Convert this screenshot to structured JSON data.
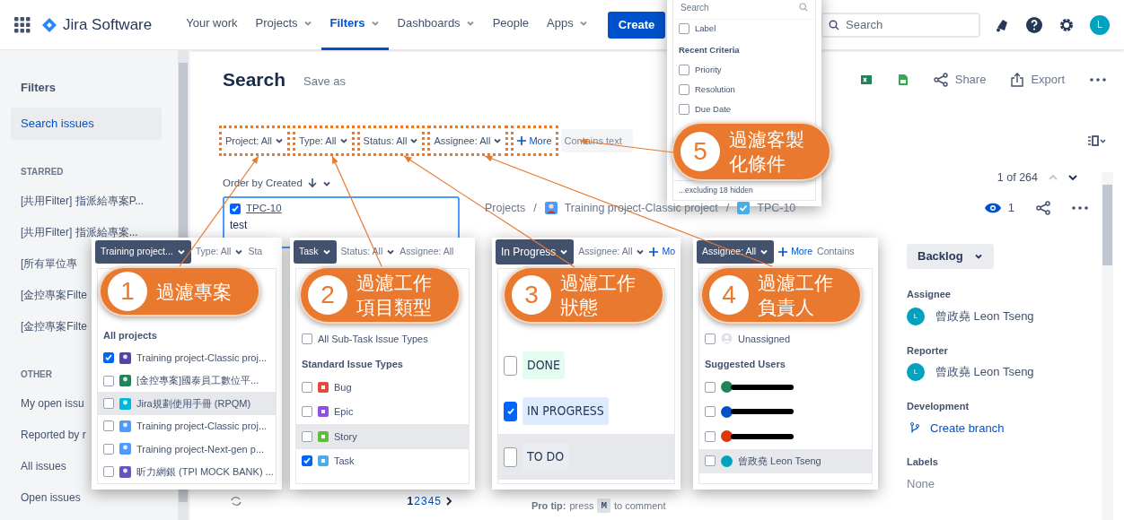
{
  "nav": {
    "product": "Jira Software",
    "items": [
      {
        "label": "Your work",
        "dropdown": false,
        "selected": false
      },
      {
        "label": "Projects",
        "dropdown": true,
        "selected": false
      },
      {
        "label": "Filters",
        "dropdown": true,
        "selected": true
      },
      {
        "label": "Dashboards",
        "dropdown": true,
        "selected": false
      },
      {
        "label": "People",
        "dropdown": false,
        "selected": false
      },
      {
        "label": "Apps",
        "dropdown": true,
        "selected": false
      }
    ],
    "create": "Create",
    "search_placeholder": "Search",
    "avatar": "L"
  },
  "sidebar": {
    "title": "Filters",
    "items": [
      {
        "label": "Search issues",
        "selected": true
      }
    ],
    "sections": [
      {
        "heading": "STARRED",
        "items": [
          "[共用Filter] 指派給專案P...",
          "[共用Filter] 指派給專案...",
          "[所有單位專",
          "[金控專案Filte",
          "[金控專案Filte"
        ]
      },
      {
        "heading": "OTHER",
        "items": [
          "My open issu",
          "Reported by r",
          "All issues",
          "Open issues"
        ]
      }
    ]
  },
  "header": {
    "title": "Search",
    "save_as": "Save as",
    "share": "Share",
    "export": "Export"
  },
  "filters": [
    {
      "kind": "filter",
      "label": "Project: All",
      "highlighted": true
    },
    {
      "kind": "filter",
      "label": "Type: All",
      "highlighted": true
    },
    {
      "kind": "filter",
      "label": "Status: All",
      "highlighted": true
    },
    {
      "kind": "filter",
      "label": "Assignee: All",
      "highlighted": true
    },
    {
      "kind": "more",
      "label": "More",
      "highlighted": true
    },
    {
      "kind": "search",
      "placeholder": "Contains text",
      "highlighted": false
    }
  ],
  "list": {
    "order": "Order by Created",
    "card": {
      "key": "TPC-10",
      "summary": "test",
      "checked": true
    },
    "pages": [
      {
        "label": "1",
        "selected": true
      },
      {
        "label": "2",
        "selected": false
      },
      {
        "label": "3",
        "selected": false
      },
      {
        "label": "4",
        "selected": false
      },
      {
        "label": "5",
        "selected": false
      }
    ]
  },
  "issue": {
    "separator": "/",
    "breadcrumbs": [
      "Projects",
      "Training project-Classic project",
      "TPC-10"
    ],
    "position": "1 of 264",
    "watchers": "1",
    "status": "Backlog",
    "fields": [
      {
        "label": "Assignee",
        "value": "曾政堯 Leon Tseng",
        "kind": "user",
        "avatar": "L"
      },
      {
        "label": "Reporter",
        "value": "曾政堯 Leon Tseng",
        "kind": "user",
        "avatar": "L"
      },
      {
        "label": "Development",
        "value": "Create branch",
        "kind": "link"
      },
      {
        "label": "Labels",
        "value": "None",
        "kind": "empty"
      }
    ],
    "tip": {
      "lead": "Pro tip:",
      "text": "press",
      "key": "M",
      "tail": "to comment"
    }
  },
  "popups": [
    {
      "kind": "criteria",
      "placeholder": "Search",
      "sections": [
        {
          "options": [
            {
              "kind": "plain",
              "label": "Label",
              "checked": false,
              "hovered": false
            }
          ]
        },
        {
          "heading": "Recent Criteria",
          "options": [
            {
              "kind": "plain",
              "label": "Priority",
              "checked": false,
              "hovered": false
            },
            {
              "kind": "plain",
              "label": "Resolution",
              "checked": false,
              "hovered": false
            },
            {
              "kind": "plain",
              "label": "Due Date",
              "checked": false,
              "hovered": false
            }
          ]
        }
      ],
      "footer": "...excluding 18 hidden"
    },
    {
      "kind": "project",
      "toolbar": [
        {
          "label": "Training project...",
          "active": true,
          "dropdown": true
        },
        {
          "label": "Type: All",
          "active": false,
          "dropdown": true
        },
        {
          "label": "Sta",
          "active": false,
          "dropdown": false
        }
      ],
      "sections": [
        {
          "heading": "All projects",
          "options": [
            {
              "kind": "project",
              "label": "Training project-Classic proj...",
              "checked": true,
              "hovered": false,
              "color": "#5243aa"
            },
            {
              "kind": "project",
              "label": "[金控專案]國泰員工數位平...",
              "checked": false,
              "hovered": false,
              "color": "#1f845a"
            },
            {
              "kind": "project",
              "label": "Jira規劃使用手冊 (RPQM)",
              "checked": false,
              "hovered": true,
              "color": "#00b8d9"
            },
            {
              "kind": "project",
              "label": "Training project-Classic proj...",
              "checked": false,
              "hovered": false,
              "color": "#4c9aff"
            },
            {
              "kind": "project",
              "label": "Training project-Next-gen p...",
              "checked": false,
              "hovered": false,
              "color": "#4c9aff"
            },
            {
              "kind": "project",
              "label": "昕力網銀 (TPI MOCK BANK) ...",
              "checked": false,
              "hovered": false,
              "color": "#6554c0"
            }
          ]
        }
      ]
    },
    {
      "kind": "type",
      "toolbar": [
        {
          "label": "Task",
          "active": true,
          "dropdown": true
        },
        {
          "label": "Status: All",
          "active": false,
          "dropdown": true
        },
        {
          "label": "Assignee: All",
          "active": false,
          "dropdown": false
        }
      ],
      "sections": [
        {
          "options": [
            {
              "kind": "plain",
              "label": "All Sub-Task Issue Types",
              "checked": false,
              "hovered": false
            }
          ]
        },
        {
          "heading": "Standard Issue Types",
          "options": [
            {
              "kind": "issue_type",
              "label": "Bug",
              "checked": false,
              "hovered": false,
              "color": "#e5493a"
            },
            {
              "kind": "issue_type",
              "label": "Epic",
              "checked": false,
              "hovered": false,
              "color": "#904ee2"
            },
            {
              "kind": "issue_type",
              "label": "Story",
              "checked": false,
              "hovered": true,
              "color": "#63ba3c"
            },
            {
              "kind": "issue_type",
              "label": "Task",
              "checked": true,
              "hovered": false,
              "color": "#4bade8"
            }
          ]
        }
      ]
    },
    {
      "kind": "status",
      "toolbar": [
        {
          "label": "In Progress",
          "active": true,
          "dropdown": true
        },
        {
          "label": "Assignee: All",
          "active": false,
          "dropdown": true
        },
        {
          "label": "Mo",
          "active": false,
          "dropdown": false,
          "plus": true
        }
      ],
      "sections": [
        {
          "options": [
            {
              "kind": "status",
              "label": "DONE",
              "checked": false,
              "hovered": false,
              "color": "#e3fcef"
            },
            {
              "kind": "status",
              "label": "IN PROGRESS",
              "checked": true,
              "hovered": false,
              "color": "#deebff"
            },
            {
              "kind": "status",
              "label": "TO DO",
              "checked": false,
              "hovered": true,
              "color": "#ebecf0"
            }
          ]
        }
      ]
    },
    {
      "kind": "assignee",
      "toolbar": [
        {
          "label": "Assignee: All",
          "active": true,
          "dropdown": true
        },
        {
          "label": "More",
          "active": false,
          "dropdown": false,
          "plus": true
        },
        {
          "label": "Contains",
          "active": false,
          "dropdown": false
        }
      ],
      "sections": [
        {
          "options": [
            {
              "kind": "unassigned",
              "label": "Unassigned",
              "checked": false,
              "hovered": false
            }
          ]
        },
        {
          "heading": "Suggested Users",
          "options": [
            {
              "kind": "redacted",
              "checked": false,
              "hovered": false,
              "color": "#1f845a"
            },
            {
              "kind": "redacted",
              "checked": false,
              "hovered": false,
              "color": "#0052cc"
            },
            {
              "kind": "redacted",
              "checked": false,
              "hovered": false,
              "color": "#de350b"
            },
            {
              "kind": "user",
              "label": "曾政堯 Leon Tseng",
              "checked": false,
              "hovered": true,
              "color": "#00a3bf"
            }
          ]
        }
      ]
    }
  ],
  "callouts": [
    {
      "number": "5",
      "lines": [
        "過濾客製",
        "化條件"
      ]
    },
    {
      "number": "1",
      "lines": [
        "過濾專案"
      ]
    },
    {
      "number": "2",
      "lines": [
        "過濾工作",
        "項目類型"
      ]
    },
    {
      "number": "3",
      "lines": [
        "過濾工作",
        "狀態"
      ]
    },
    {
      "number": "4",
      "lines": [
        "過濾工作",
        "負責人"
      ]
    }
  ]
}
